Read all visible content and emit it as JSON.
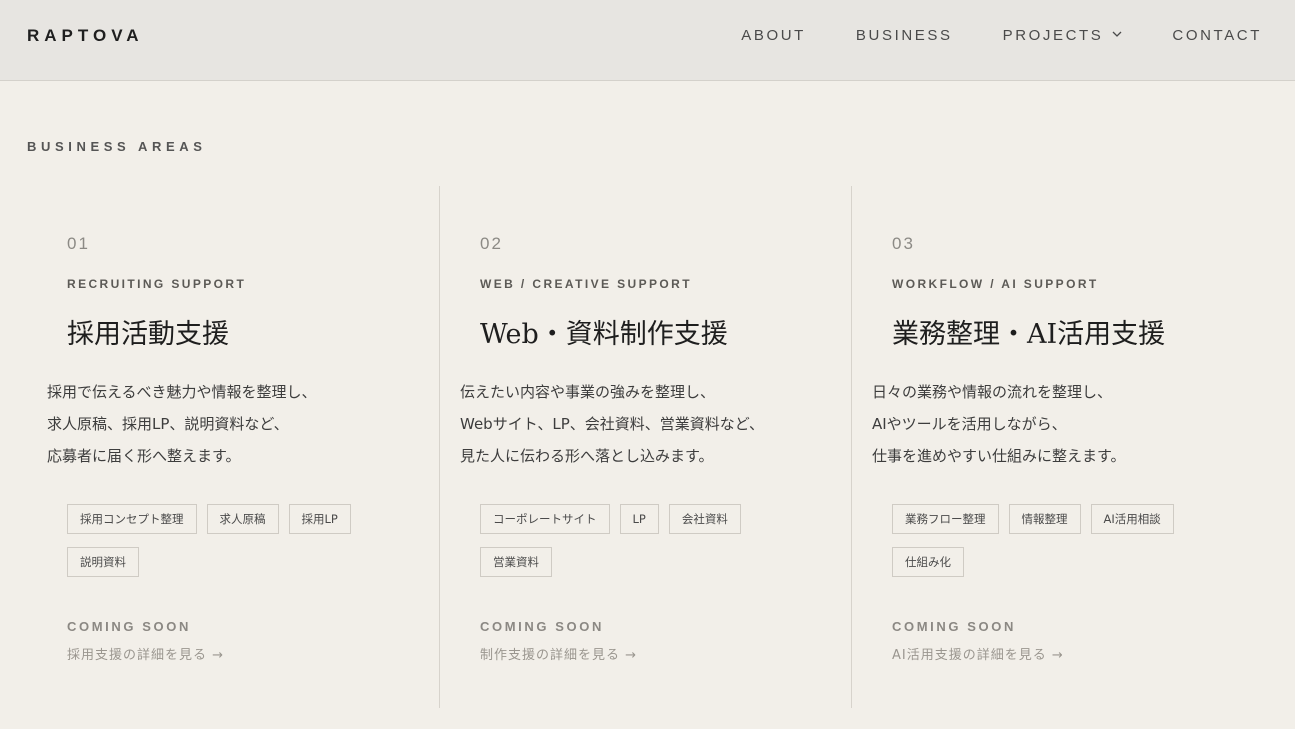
{
  "header": {
    "logo": "RAPTOVA",
    "nav": [
      {
        "label": "ABOUT"
      },
      {
        "label": "BUSINESS"
      },
      {
        "label": "PROJECTS",
        "dropdown": true
      },
      {
        "label": "CONTACT"
      }
    ]
  },
  "section": {
    "label": "BUSINESS AREAS"
  },
  "areas": [
    {
      "num": "01",
      "subtitle": "RECRUITING SUPPORT",
      "title": "採用活動支援",
      "desc": [
        "採用で伝えるべき魅力や情報を整理し、",
        "求人原稿、採用LP、説明資料など、",
        "応募者に届く形へ整えます。"
      ],
      "tags": [
        "採用コンセプト整理",
        "求人原稿",
        "採用LP",
        "説明資料"
      ],
      "status": "COMING SOON",
      "link": "採用支援の詳細を見る →"
    },
    {
      "num": "02",
      "subtitle": "WEB / CREATIVE SUPPORT",
      "title": "Web・資料制作支援",
      "desc": [
        "伝えたい内容や事業の強みを整理し、",
        "Webサイト、LP、会社資料、営業資料など、",
        "見た人に伝わる形へ落とし込みます。"
      ],
      "tags": [
        "コーポレートサイト",
        "LP",
        "会社資料",
        "営業資料"
      ],
      "status": "COMING SOON",
      "link": "制作支援の詳細を見る →"
    },
    {
      "num": "03",
      "subtitle": "WORKFLOW / AI SUPPORT",
      "title": "業務整理・AI活用支援",
      "desc": [
        "日々の業務や情報の流れを整理し、",
        "AIやツールを活用しながら、",
        "仕事を進めやすい仕組みに整えます。"
      ],
      "tags": [
        "業務フロー整理",
        "情報整理",
        "AI活用相談",
        "仕組み化"
      ],
      "status": "COMING SOON",
      "link": "AI活用支援の詳細を見る →"
    }
  ],
  "colors": {
    "background": "#f2efe9",
    "header": "#e7e5e1",
    "text": "#2b2b2b",
    "muted": "#8c8a85"
  }
}
